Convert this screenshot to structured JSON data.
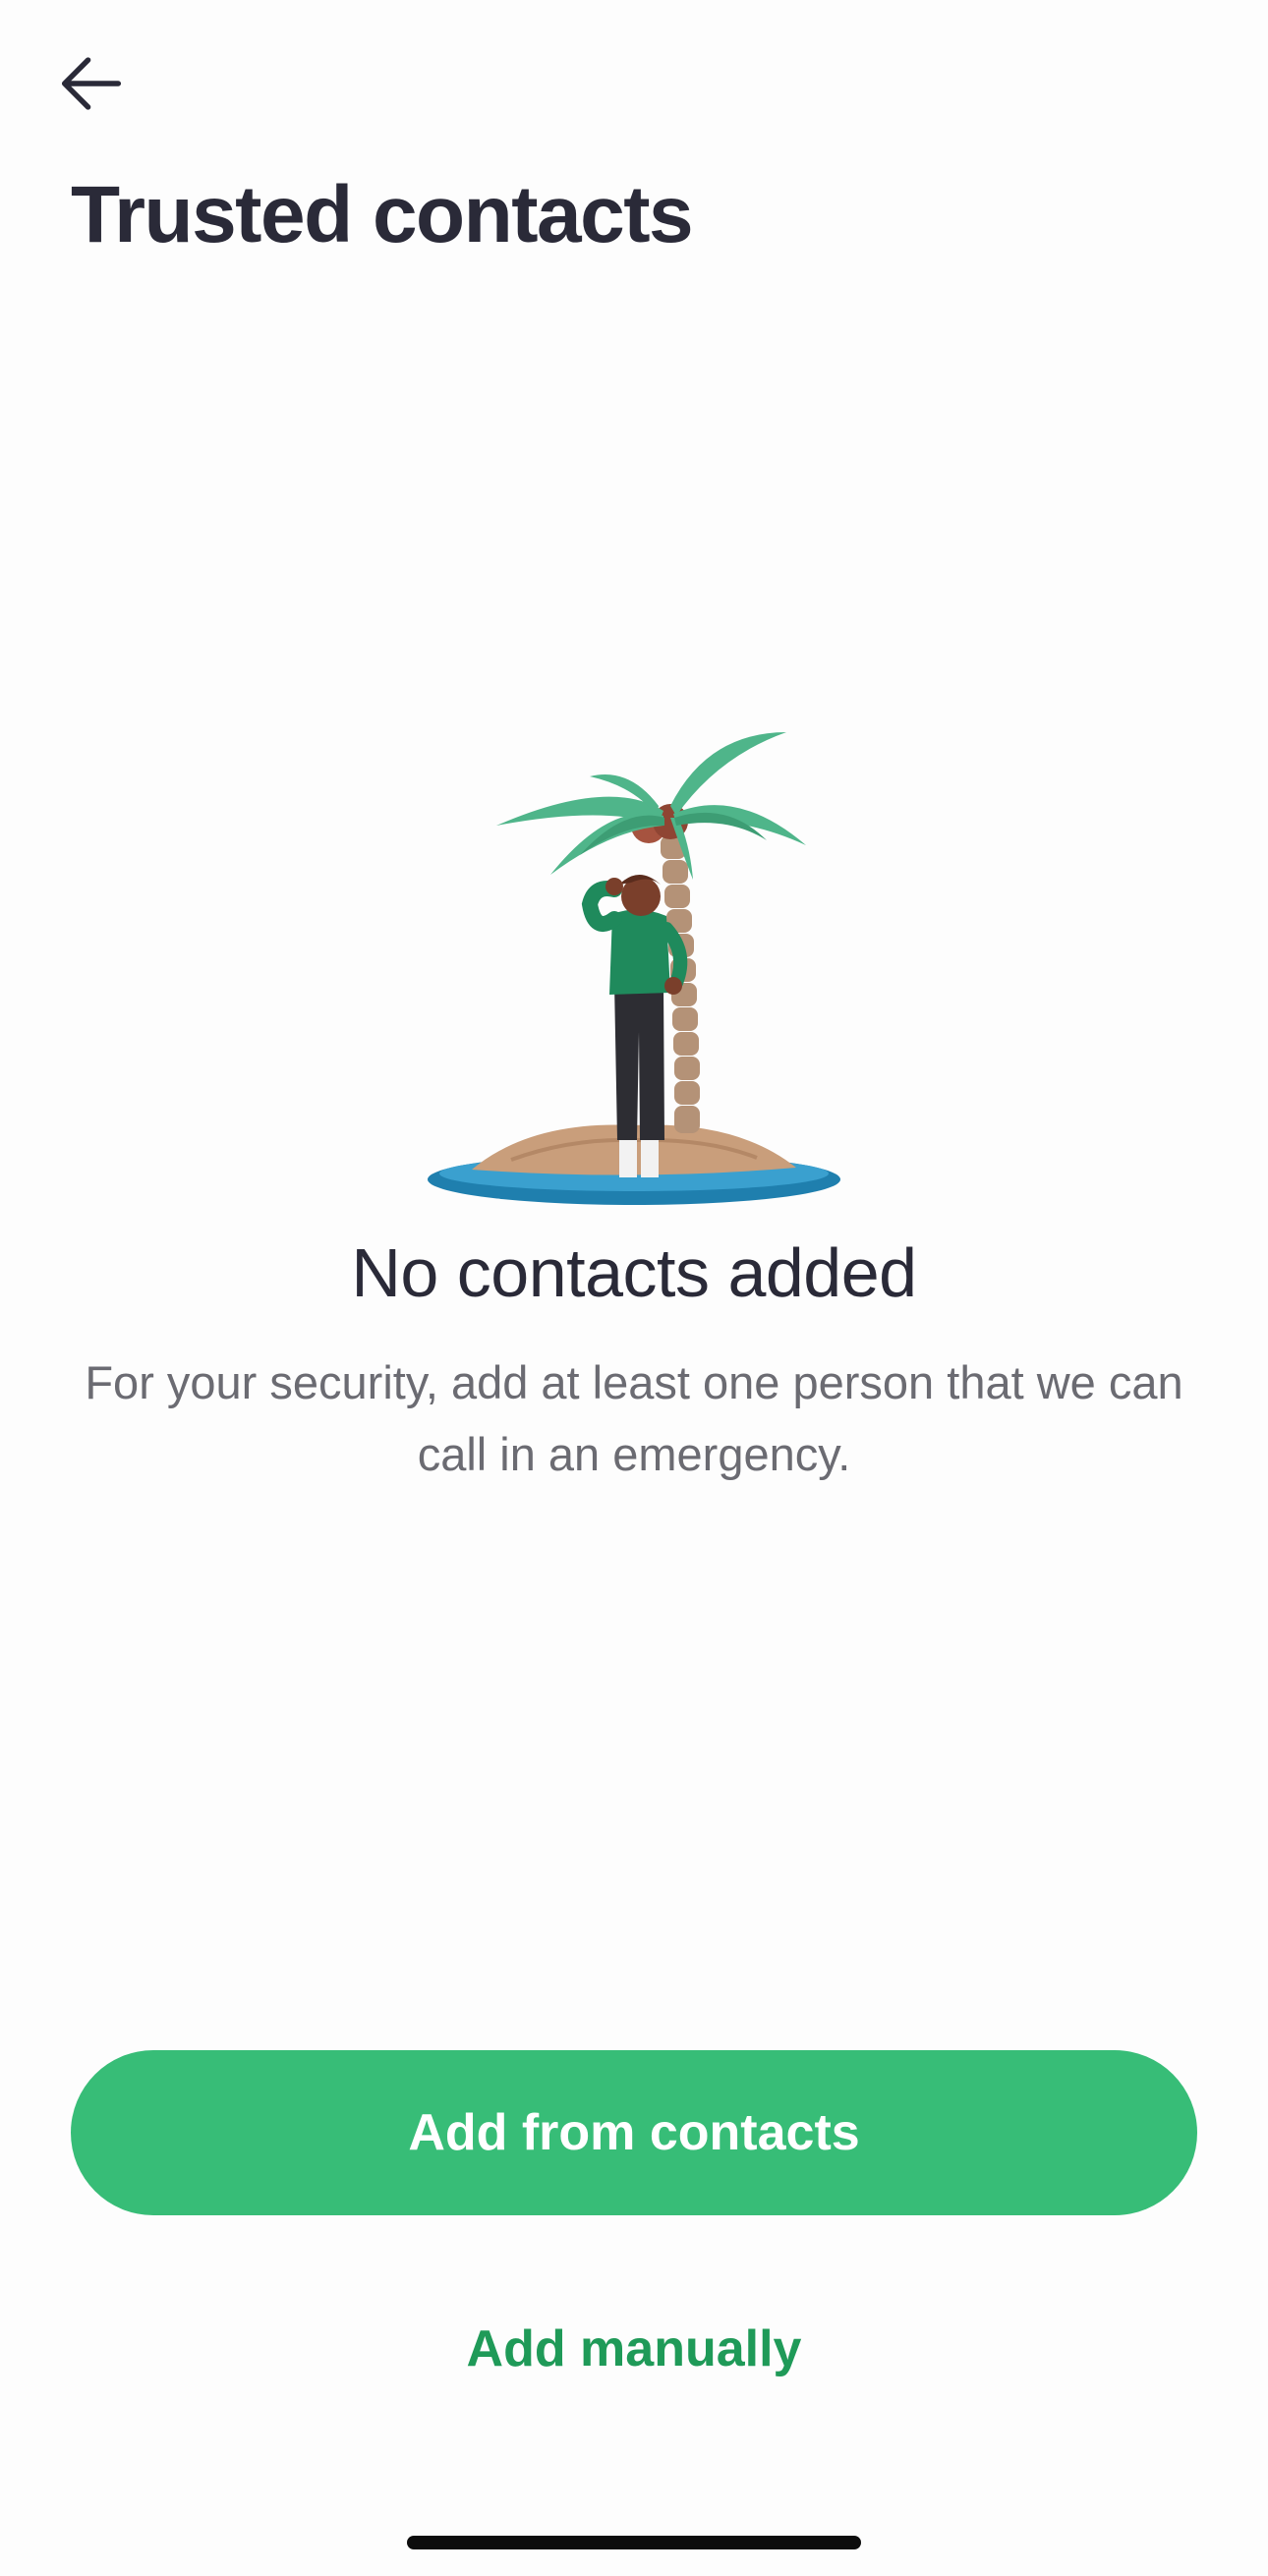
{
  "header": {
    "back_icon": "arrow-left-icon",
    "title": "Trusted contacts"
  },
  "empty_state": {
    "illustration": "palm-tree-island-person-illustration",
    "title": "No contacts added",
    "description": "For your security, add at least one person that we can call in an emergency."
  },
  "actions": {
    "primary_label": "Add from contacts",
    "secondary_label": "Add manually"
  },
  "colors": {
    "accent": "#37bd77",
    "accent_text": "#1f9a58",
    "text_primary": "#2a2a38",
    "text_secondary": "#6b6b72",
    "background": "#fdfdfd"
  }
}
